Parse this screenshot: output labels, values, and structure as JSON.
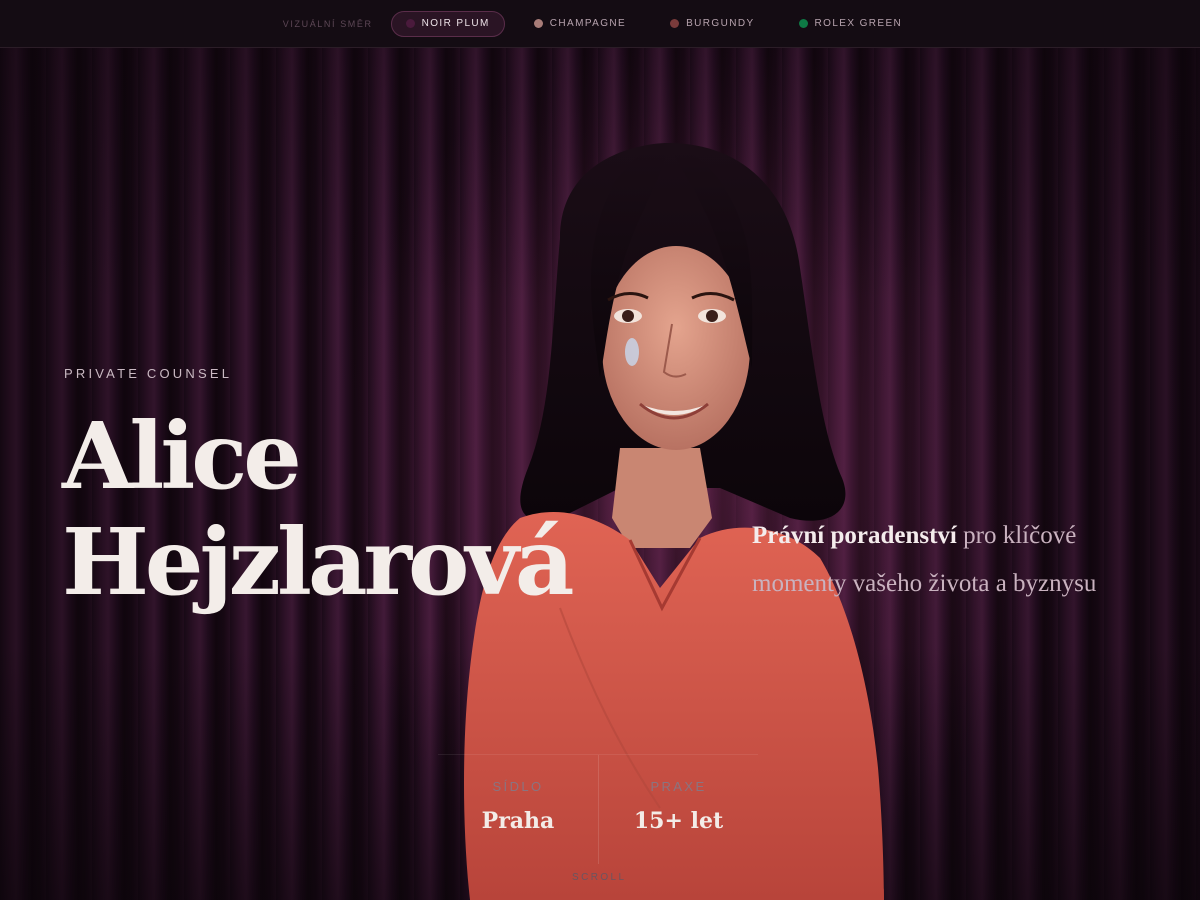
{
  "switcher": {
    "label": "Vizuální směr",
    "options": [
      {
        "label": "Noir Plum",
        "color": "#4a1a3c",
        "active": true
      },
      {
        "label": "Champagne",
        "color": "#a87c78",
        "active": false
      },
      {
        "label": "Burgundy",
        "color": "#7a3b3b",
        "active": false
      },
      {
        "label": "Rolex Green",
        "color": "#0e7a45",
        "active": false
      }
    ]
  },
  "hero": {
    "kicker": "Private Counsel",
    "name_line1": "Alice",
    "name_line2": "Hejzlarová",
    "tagline_strong": "Právní poradenství",
    "tagline_rest": " pro klíčové momenty vašeho života a byznysu",
    "facts": [
      {
        "label": "Sídlo",
        "value": "Praha"
      },
      {
        "label": "Praxe",
        "value": "15+ let"
      }
    ],
    "scroll_label": "Scroll"
  },
  "colors": {
    "background": "#120910",
    "curtain": "#3a1632",
    "dress": "#d9574a",
    "text": "#f3ede9"
  }
}
